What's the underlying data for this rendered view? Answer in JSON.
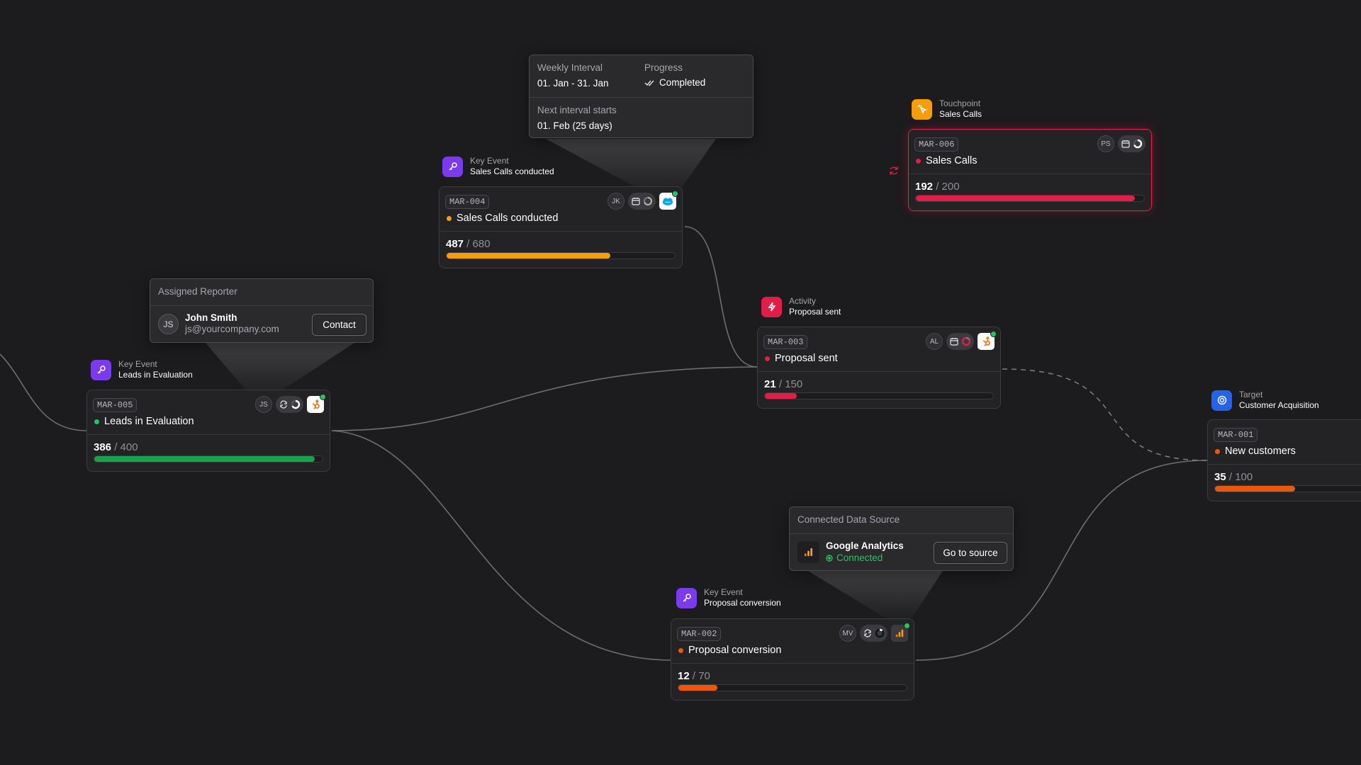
{
  "nodes": [
    {
      "key": "mar004",
      "tag_type": "Key Event",
      "tag_name": "Sales Calls conducted",
      "id": "MAR-004",
      "title": "Sales Calls conducted",
      "current": "487",
      "target": "680",
      "progress": 0.716,
      "assignee": "JK",
      "status_color": "#f59e0b",
      "bar_color": "#f59e0b",
      "tag_color": "#7c3aed",
      "tag_icon": "key-icon",
      "source_icon": "salesforce-logo-icon"
    },
    {
      "key": "mar005",
      "tag_type": "Key Event",
      "tag_name": "Leads in Evaluation",
      "id": "MAR-005",
      "title": "Leads in Evaluation",
      "current": "386",
      "target": "400",
      "progress": 0.965,
      "assignee": "JS",
      "status_color": "#22c55e",
      "bar_color": "#16a34a",
      "tag_color": "#7c3aed",
      "tag_icon": "key-icon",
      "source_icon": "hubspot-logo-icon"
    },
    {
      "key": "mar003",
      "tag_type": "Activity",
      "tag_name": "Proposal sent",
      "id": "MAR-003",
      "title": "Proposal sent",
      "current": "21",
      "target": "150",
      "progress": 0.14,
      "assignee": "AL",
      "status_color": "#e11d48",
      "bar_color": "#e11d48",
      "tag_color": "#e11d48",
      "tag_icon": "lightning-icon",
      "source_icon": "hubspot-logo-icon"
    },
    {
      "key": "mar006",
      "tag_type": "Touchpoint",
      "tag_name": "Sales Calls",
      "id": "MAR-006",
      "title": "Sales Calls",
      "current": "192",
      "target": "200",
      "progress": 0.96,
      "assignee": "PS",
      "status_color": "#e11d48",
      "bar_color": "#e11d48",
      "tag_color": "#f59e0b",
      "tag_icon": "pointer-icon",
      "source_icon": "none"
    },
    {
      "key": "mar002",
      "tag_type": "Key Event",
      "tag_name": "Proposal conversion",
      "id": "MAR-002",
      "title": "Proposal conversion",
      "current": "12",
      "target": "70",
      "progress": 0.171,
      "assignee": "MV",
      "status_color": "#ea580c",
      "bar_color": "#ea580c",
      "tag_color": "#7c3aed",
      "tag_icon": "key-icon",
      "source_icon": "google-analytics-logo-icon"
    },
    {
      "key": "mar001",
      "tag_type": "Target",
      "tag_name": "Customer Acquisition",
      "id": "MAR-001",
      "title": "New customers",
      "current": "35",
      "target": "100",
      "progress": 0.35,
      "assignee": "",
      "status_color": "#ea580c",
      "bar_color": "#ea580c",
      "tag_color": "#2563eb",
      "tag_icon": "target-icon",
      "source_icon": "none"
    }
  ],
  "interval_popover": {
    "interval_label": "Weekly Interval",
    "interval_value": "01. Jan - 31. Jan",
    "progress_label": "Progress",
    "progress_value": "Completed",
    "next_label": "Next interval starts",
    "next_value": "01. Feb (25 days)"
  },
  "reporter_popover": {
    "title": "Assigned Reporter",
    "initials": "JS",
    "name": "John Smith",
    "email": "js@yourcompany.com",
    "button": "Contact"
  },
  "source_popover": {
    "title": "Connected Data Source",
    "name": "Google Analytics",
    "status": "Connected",
    "button": "Go to source",
    "status_color": "#22c55e"
  },
  "colors": {
    "background": "#1c1b1d",
    "card": "#232326",
    "edge": "#6b6b70"
  }
}
